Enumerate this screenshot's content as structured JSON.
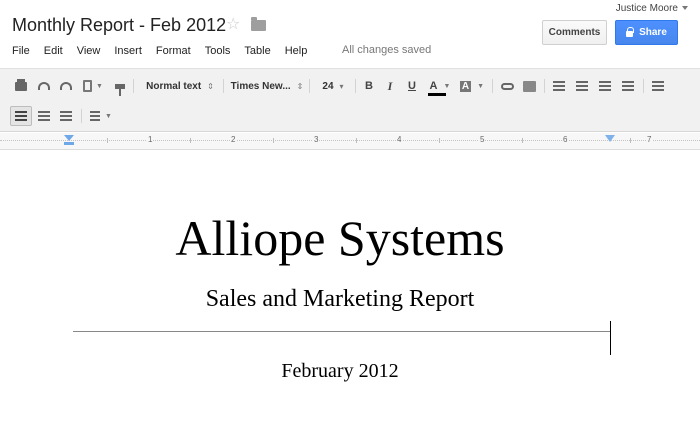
{
  "header": {
    "title": "Monthly Report - Feb 2012",
    "user": "Justice Moore",
    "comments_label": "Comments",
    "share_label": "Share",
    "saved_status": "All changes saved"
  },
  "menu": [
    "File",
    "Edit",
    "View",
    "Insert",
    "Format",
    "Tools",
    "Table",
    "Help"
  ],
  "toolbar": {
    "style": "Normal text",
    "font": "Times New...",
    "size": "24",
    "bold": "B",
    "italic": "I",
    "underline": "U",
    "text_color": "A",
    "highlight": "A",
    "text_color_value": "#000000"
  },
  "ruler": {
    "marks": [
      "1",
      "2",
      "3",
      "4",
      "5",
      "6",
      "7"
    ]
  },
  "document": {
    "heading": "Alliope Systems",
    "subheading": "Sales and Marketing Report",
    "date": "February 2012"
  },
  "colors": {
    "share_button": "#4d90fe",
    "toolbar_bg": "#f1f1f1",
    "indent_marker": "#6fa8e8"
  },
  "icons": [
    "star-icon",
    "folder-icon",
    "lock-icon",
    "print-icon",
    "undo-icon",
    "redo-icon",
    "paste-icon",
    "paint-format-icon",
    "link-icon",
    "image-icon",
    "numbered-list-icon",
    "bulleted-list-icon",
    "decrease-indent-icon",
    "increase-indent-icon",
    "align-left-icon",
    "align-center-icon",
    "align-right-icon",
    "justify-icon",
    "line-spacing-icon"
  ]
}
